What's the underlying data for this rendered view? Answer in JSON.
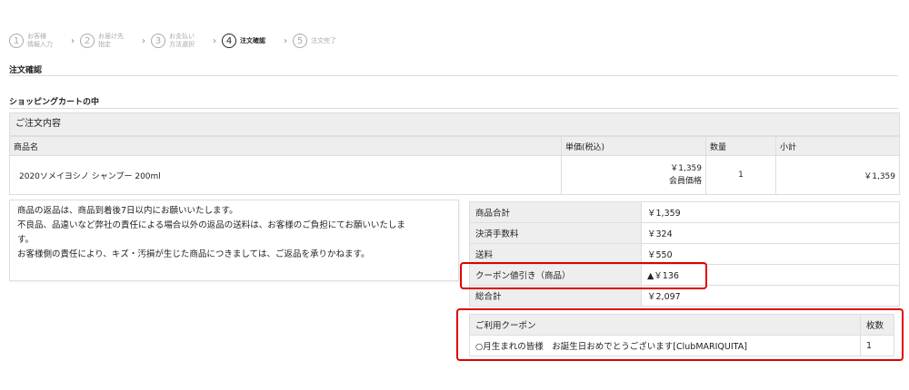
{
  "steps": [
    {
      "num": "1",
      "label": "お客様\n情報入力"
    },
    {
      "num": "2",
      "label": "お届け先\n指定"
    },
    {
      "num": "3",
      "label": "お支払い\n方法選択"
    },
    {
      "num": "4",
      "label": "注文確認"
    },
    {
      "num": "5",
      "label": "注文完了"
    }
  ],
  "section1": "注文確認",
  "section2": "ショッピングカートの中",
  "order": {
    "header": "ご注文内容",
    "columns": {
      "name": "商品名",
      "price": "単価(税込)",
      "qty": "数量",
      "subtotal": "小計"
    },
    "item": {
      "name": "2020ソメイヨシノ シャンプー 200ml",
      "price": "￥1,359",
      "price_note": "会員価格",
      "qty": "1",
      "subtotal": "￥1,359"
    }
  },
  "notice": [
    "商品の返品は、商品到着後7日以内にお願いいたします。",
    "不良品、品違いなど弊社の責任による場合以外の返品の送料は、お客様のご負担にてお願いいたしま",
    "す。",
    "お客様側の責任により、キズ・汚損が生じた商品につきましては、ご返品を承りかねます。"
  ],
  "summary": {
    "goods_label": "商品合計",
    "goods_value": "￥1,359",
    "fee_label": "決済手数料",
    "fee_value": "￥324",
    "ship_label": "送料",
    "ship_value": "￥550",
    "coupon_label": "クーポン値引き（商品）",
    "coupon_value": "▲￥136",
    "total_label": "総合計",
    "total_value": "￥2,097"
  },
  "coupon": {
    "col_name": "ご利用クーポン",
    "col_count": "枚数",
    "name": "○月生まれの皆様　お誕生日おめでとうございます[ClubMARIQUITA]",
    "count": "1"
  },
  "colors": {
    "highlight": "#e00000"
  }
}
